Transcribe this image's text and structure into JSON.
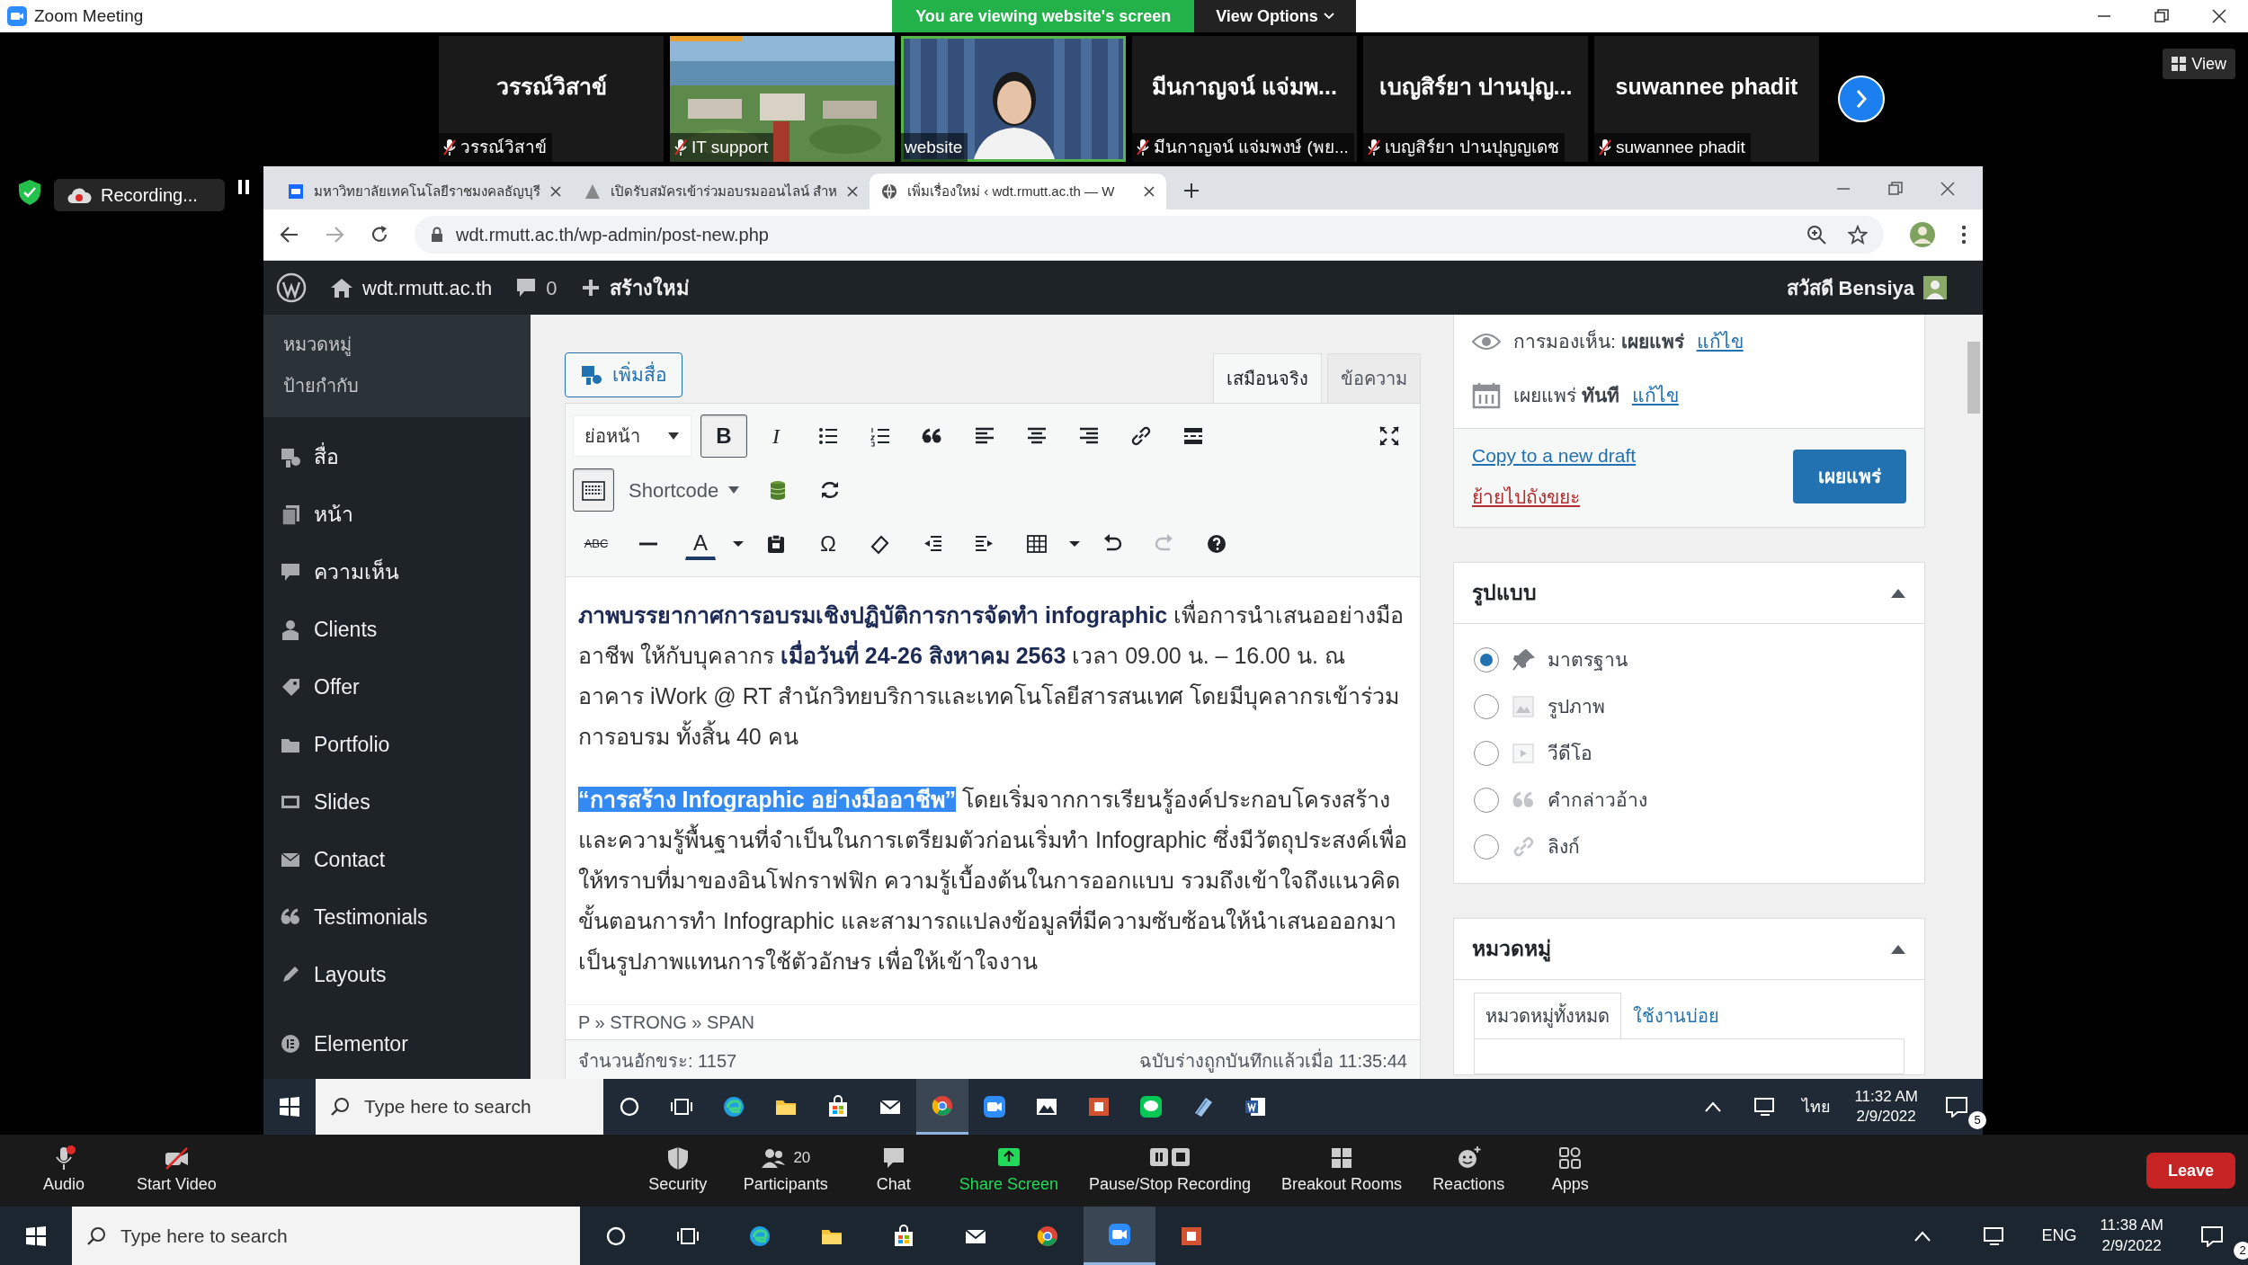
{
  "zoom": {
    "title": "Zoom Meeting",
    "banner": "You are viewing website's screen",
    "view_options": "View Options",
    "view": "View"
  },
  "video_tiles": [
    {
      "kind": "name",
      "name": "วรรณ์วิสาข์",
      "label": "วรรณ์วิสาข์",
      "muted": true
    },
    {
      "kind": "picture",
      "label": "IT support",
      "muted": true
    },
    {
      "kind": "person",
      "label": "website",
      "muted": false
    },
    {
      "kind": "name",
      "name": "มีนกาญจน์ แจ่มพ...",
      "label": "มีนกาญจน์ แจ่มพงษ์ (พย...",
      "muted": true
    },
    {
      "kind": "name",
      "name": "เบญสิร์ยา ปานปุญ...",
      "label": "เบญสิร์ยา ปานปุญญเดช",
      "muted": true
    },
    {
      "kind": "name",
      "name": "suwannee phadit",
      "label": "suwannee phadit",
      "muted": true
    }
  ],
  "recording": {
    "label": "Recording..."
  },
  "browser": {
    "tabs": [
      {
        "title": "มหาวิทยาลัยเทคโนโลยีราชมงคลธัญบุรี",
        "selected": false
      },
      {
        "title": "เปิดรับสมัครเข้าร่วมอบรมออนไลน์ สำห",
        "selected": false
      },
      {
        "title": "เพิ่มเรื่องใหม่ ‹ wdt.rmutt.ac.th — W",
        "selected": true
      }
    ],
    "url": "wdt.rmutt.ac.th/wp-admin/post-new.php"
  },
  "admin_bar": {
    "site": "wdt.rmutt.ac.th",
    "comments": "0",
    "new": "สร้างใหม่",
    "greeting": "สวัสดี Bensiya"
  },
  "wp_menu": [
    {
      "kind": "sub",
      "label": "หมวดหมู่"
    },
    {
      "kind": "sub",
      "label": "ป้ายกำกับ"
    },
    {
      "kind": "main",
      "label": "สื่อ"
    },
    {
      "kind": "main",
      "label": "หน้า"
    },
    {
      "kind": "main",
      "label": "ความเห็น"
    },
    {
      "kind": "main",
      "label": "Clients"
    },
    {
      "kind": "main",
      "label": "Offer"
    },
    {
      "kind": "main",
      "label": "Portfolio"
    },
    {
      "kind": "main",
      "label": "Slides"
    },
    {
      "kind": "main",
      "label": "Contact"
    },
    {
      "kind": "main",
      "label": "Testimonials"
    },
    {
      "kind": "main",
      "label": "Layouts"
    },
    {
      "kind": "main",
      "label": "Elementor"
    }
  ],
  "editor": {
    "add_media": "เพิ่มสื่อ",
    "tabs": [
      {
        "label": "เสมือนจริง",
        "selected": true
      },
      {
        "label": "ข้อความ",
        "selected": false
      }
    ],
    "toolbar_rows": [
      [
        {
          "kind": "select",
          "label": "ย่อหน้า"
        },
        {
          "kind": "text",
          "label": "B",
          "pressed": true
        },
        {
          "kind": "text",
          "label": "I",
          "pressed": false
        },
        {
          "kind": "icon",
          "pressed": false
        },
        {
          "kind": "icon",
          "pressed": false
        },
        {
          "kind": "icon",
          "pressed": false
        },
        {
          "kind": "icon",
          "pressed": false
        },
        {
          "kind": "icon",
          "pressed": false
        },
        {
          "kind": "icon",
          "pressed": false
        },
        {
          "kind": "icon",
          "pressed": false
        },
        {
          "kind": "icon",
          "pressed": false
        },
        {
          "kind": "icon",
          "pressed": false
        }
      ],
      [
        {
          "kind": "icon",
          "pressed": true
        },
        {
          "kind": "dropdown",
          "label": "Shortcode"
        },
        {
          "kind": "icon",
          "pressed": false
        },
        {
          "kind": "icon",
          "pressed": false
        }
      ],
      [
        {
          "kind": "text",
          "label": "ABC",
          "pressed": false
        },
        {
          "kind": "icon",
          "pressed": false
        },
        {
          "kind": "text",
          "label": "A",
          "pressed": false
        },
        {
          "kind": "icon",
          "pressed": false
        },
        {
          "kind": "icon",
          "pressed": false
        },
        {
          "kind": "text",
          "label": "Ω",
          "pressed": false
        },
        {
          "kind": "icon",
          "pressed": false
        },
        {
          "kind": "icon",
          "pressed": false
        },
        {
          "kind": "icon",
          "pressed": false
        },
        {
          "kind": "icon",
          "pressed": false
        },
        {
          "kind": "icon",
          "pressed": false
        },
        {
          "kind": "icon",
          "pressed": false
        },
        {
          "kind": "icon",
          "pressed": false
        },
        {
          "kind": "icon",
          "pressed": false
        }
      ]
    ],
    "paragraphs": [
      {
        "kind": "plain",
        "text": "**ภาพบรรยากาศการอบรมเชิงปฏิบัติการการจัดทำ infographic** เพื่อการนำเสนออย่างมืออาชีพ ให้กับบุคลากร **เมื่อวันที่ 24-26 สิงหาคม 2563** เวลา 09.00 น. – 16.00 น. ณ อาคาร iWork @ RT สำนักวิทยบริการและเทคโนโลยีสารสนเทศ โดยมีบุคลากรเข้าร่วมการอบรม ทั้งสิ้น 40 คน"
      },
      {
        "kind": "selection",
        "selected_text": "“การสร้าง Infographic อย่างมืออาชีพ”",
        "text": " โดยเริ่มจากการเรียนรู้องค์ประกอบโครงสร้าง และความรู้พื้นฐานที่จำเป็นในการเตรียมตัวก่อนเริ่มทำ Infographic ซึ่งมีวัตถุประสงค์เพื่อให้ทราบที่มาของอินโฟกราฟฟิก ความรู้เบื้องต้นในการออกแบบ รวมถึงเข้าใจถึงแนวคิดขั้นตอนการทำ Infographic และสามารถแปลงข้อมูลที่มีความซับซ้อนให้นำเสนอออกมาเป็นรูปภาพแทนการใช้ตัวอักษร เพื่อให้เข้าใจงาน"
      }
    ],
    "path": "P » STRONG » SPAN",
    "word_count": "จำนวนอักขระ: 1157",
    "saved": "ฉบับร่างถูกบันทึกแล้วเมื่อ 11:35:44"
  },
  "publish": {
    "visibility": "การมองเห็น: **เผยแพร่**",
    "visibility_edit": "แก้ไข",
    "schedule": "เผยแพร่ **ทันที**",
    "schedule_edit": "แก้ไข",
    "copy": "Copy to a new draft",
    "trash": "ย้ายไปถังขยะ",
    "button": "เผยแพร่"
  },
  "format_box": {
    "title": "รูปแบบ",
    "options": [
      {
        "label": "มาตรฐาน",
        "selected": true
      },
      {
        "label": "รูปภาพ",
        "selected": false
      },
      {
        "label": "วีดีโอ",
        "selected": false
      },
      {
        "label": "คำกล่าวอ้าง",
        "selected": false
      },
      {
        "label": "ลิงก์",
        "selected": false
      }
    ]
  },
  "category_box": {
    "title": "หมวดหมู่",
    "tabs": [
      {
        "label": "หมวดหมู่ทั้งหมด",
        "selected": true
      },
      {
        "label": "ใช้งานบ่อย",
        "selected": false
      }
    ]
  },
  "remote_taskbar": {
    "search": "Type here to search",
    "lang": "ไทย",
    "time": "11:32 AM",
    "date": "2/9/2022",
    "notifications": "5"
  },
  "zoom_toolbar": {
    "items": [
      {
        "kind": "left",
        "label": "Audio"
      },
      {
        "kind": "left",
        "label": "Start Video"
      },
      {
        "kind": "center",
        "label": "Security"
      },
      {
        "kind": "center",
        "label": "Participants",
        "count": "20"
      },
      {
        "kind": "center",
        "label": "Chat"
      },
      {
        "kind": "share",
        "label": "Share Screen"
      },
      {
        "kind": "center",
        "label": "Pause/Stop Recording"
      },
      {
        "kind": "center",
        "label": "Breakout Rooms"
      },
      {
        "kind": "center",
        "label": "Reactions"
      },
      {
        "kind": "center",
        "label": "Apps"
      }
    ],
    "leave": "Leave"
  },
  "taskbar": {
    "search": "Type here to search",
    "lang": "ENG",
    "time": "11:38 AM",
    "date": "2/9/2022",
    "notifications": "2"
  }
}
